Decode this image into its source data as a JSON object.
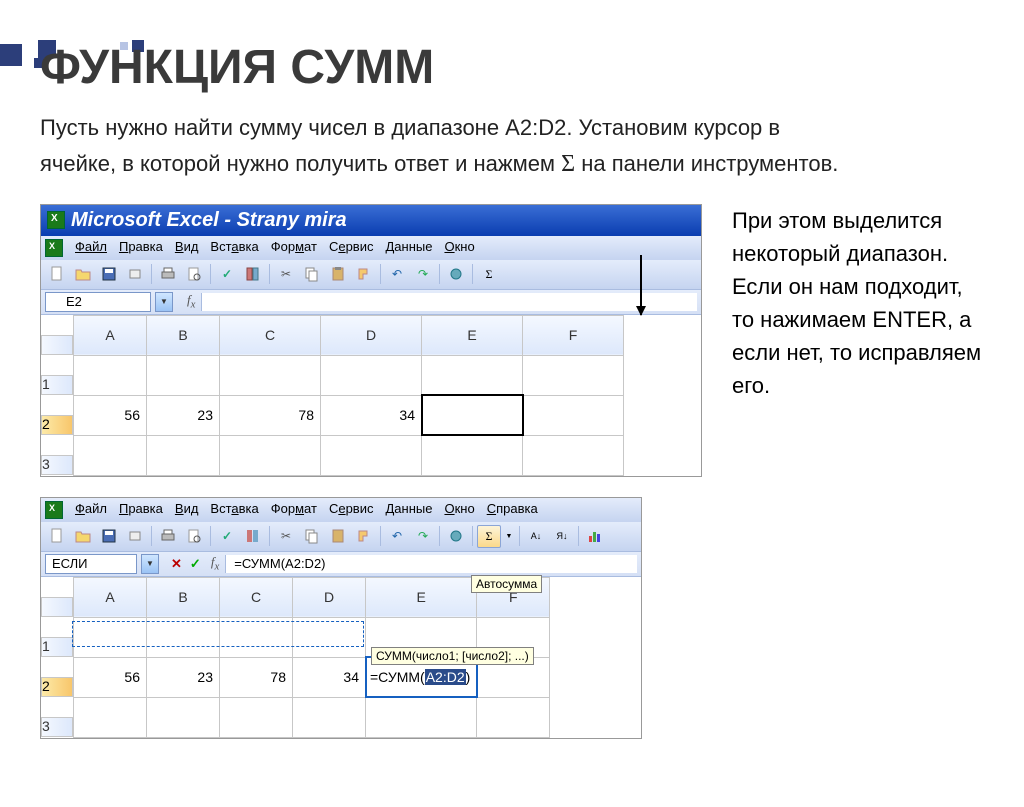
{
  "slide": {
    "title": "ФУНКЦИЯ СУММ",
    "desc_1": "Пусть нужно найти сумму чисел в диапазоне A2:D2. Установим курсор в",
    "desc_2": "ячейке, в которой нужно получить ответ и нажмем ",
    "desc_3": " на панели инструментов.",
    "side_text": "При этом выделится некоторый диапазон. Если он нам подходит, то нажимаем ENTER, а если нет, то исправляем его."
  },
  "excel1": {
    "title": "Microsoft Excel - Strany mira",
    "menu": [
      "Файл",
      "Правка",
      "Вид",
      "Вставка",
      "Формат",
      "Сервис",
      "Данные",
      "Окно"
    ],
    "namebox": "E2",
    "cols": [
      "A",
      "B",
      "C",
      "D",
      "E",
      "F"
    ],
    "active_col": "E",
    "rows": [
      "1",
      "2",
      "3"
    ],
    "active_row": "2",
    "r2": {
      "A": "56",
      "B": "23",
      "C": "78",
      "D": "34"
    }
  },
  "excel2": {
    "menu": [
      "Файл",
      "Правка",
      "Вид",
      "Вставка",
      "Формат",
      "Сервис",
      "Данные",
      "Окно",
      "Справка"
    ],
    "namebox": "ЕСЛИ",
    "formula": "=СУММ(A2:D2)",
    "autosum_tip": "Автосумма",
    "cols": [
      "A",
      "B",
      "C",
      "D",
      "E",
      "F"
    ],
    "active_col": "E",
    "rows": [
      "1",
      "2",
      "3"
    ],
    "active_row": "2",
    "r2": {
      "A": "56",
      "B": "23",
      "C": "78",
      "D": "34"
    },
    "cell_formula_pre": "=СУММ(",
    "cell_formula_hl": "A2:D2",
    "cell_formula_post": ")",
    "fn_tip": "СУММ(число1; [число2]; ...)"
  }
}
